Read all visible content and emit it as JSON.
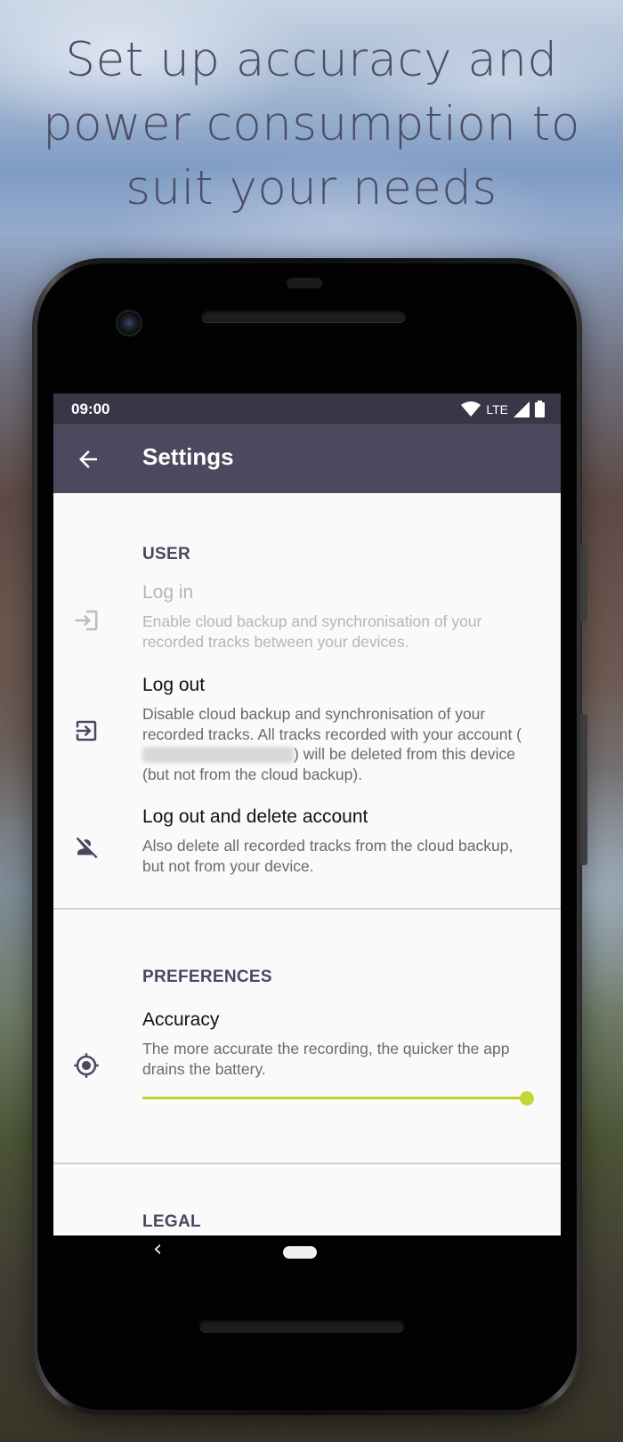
{
  "headline": {
    "line1": "Set up accuracy and",
    "line2": "power consumption to",
    "line3": "suit your needs"
  },
  "status_bar": {
    "time": "09:00",
    "network": "LTE",
    "icons": [
      "wifi-icon",
      "signal-icon",
      "battery-icon"
    ]
  },
  "app_bar": {
    "title": "Settings",
    "back_icon": "arrow-back-icon"
  },
  "sections": {
    "user": {
      "header": "USER",
      "items": [
        {
          "title": "Log in",
          "summary": "Enable cloud backup and synchronisation of your recorded tracks between your devices.",
          "icon": "login-icon",
          "enabled": false
        },
        {
          "title": "Log out",
          "summary_before": "Disable cloud backup and synchronisation of your recorded tracks. All tracks recorded with your account (",
          "summary_after": ") will be deleted from this device (but not from the cloud backup).",
          "icon": "logout-icon",
          "enabled": true
        },
        {
          "title": "Log out and delete account",
          "summary": "Also delete all recorded tracks from the cloud backup, but not from your device.",
          "icon": "person-off-icon",
          "enabled": true
        }
      ]
    },
    "preferences": {
      "header": "PREFERENCES",
      "items": [
        {
          "title": "Accuracy",
          "summary": "The more accurate the recording, the quicker the app drains the battery.",
          "icon": "gps-fixed-icon",
          "slider_value": 1.0
        }
      ]
    },
    "legal": {
      "header": "LEGAL"
    }
  },
  "colors": {
    "status_bar": "#3a3547",
    "app_bar": "#4d485e",
    "section_header": "#4b4760",
    "slider_accent": "#c4d636",
    "headline": "#4b4d66"
  }
}
